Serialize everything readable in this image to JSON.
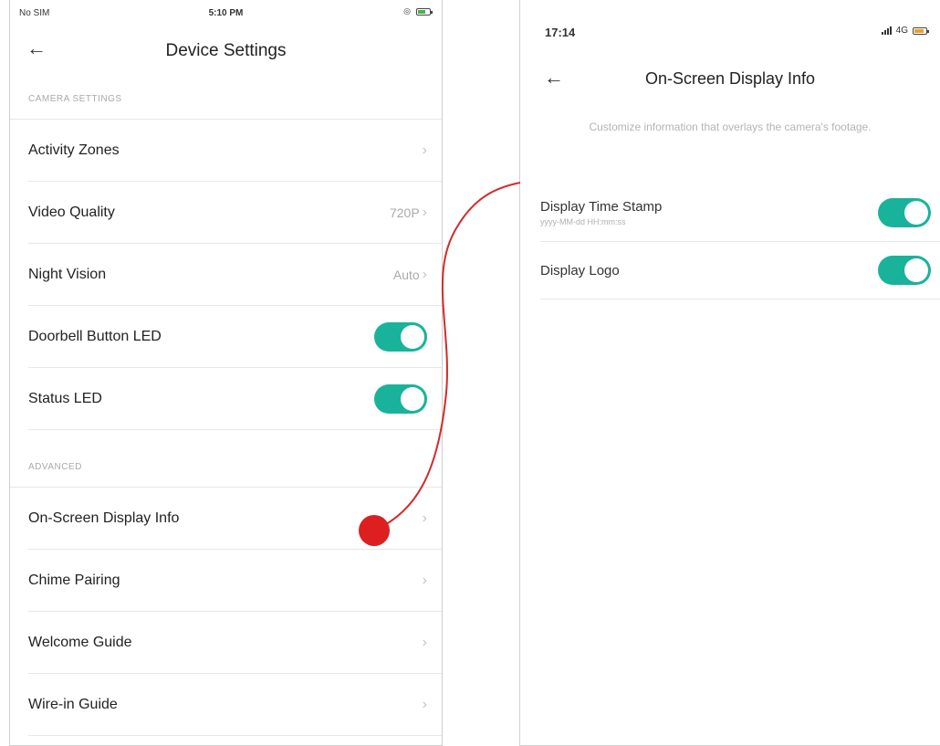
{
  "left": {
    "status": {
      "carrier": "No SIM",
      "time": "5:10 PM"
    },
    "title": "Device Settings",
    "camera_section": "CAMERA SETTINGS",
    "camera_items": [
      {
        "label": "Activity Zones",
        "value": "",
        "type": "chevron"
      },
      {
        "label": "Video Quality",
        "value": "720P",
        "type": "chevron"
      },
      {
        "label": "Night Vision",
        "value": "Auto",
        "type": "chevron"
      },
      {
        "label": "Doorbell Button LED",
        "value": "",
        "type": "toggle",
        "on": true
      },
      {
        "label": "Status LED",
        "value": "",
        "type": "toggle",
        "on": true
      }
    ],
    "advanced_section": "ADVANCED",
    "advanced_items": [
      {
        "label": "On-Screen Display Info"
      },
      {
        "label": "Chime Pairing"
      },
      {
        "label": "Welcome Guide"
      },
      {
        "label": "Wire-in Guide"
      }
    ]
  },
  "right": {
    "status": {
      "time": "17:14",
      "network": "4G"
    },
    "title": "On-Screen Display Info",
    "description": "Customize information that overlays the camera's footage.",
    "items": [
      {
        "label": "Display Time Stamp",
        "sub": "yyyy-MM-dd HH:mm:ss",
        "on": true
      },
      {
        "label": "Display Logo",
        "sub": "",
        "on": true
      }
    ]
  },
  "colors": {
    "toggle_on": "#19b39b",
    "connector": "#d42a2a"
  }
}
